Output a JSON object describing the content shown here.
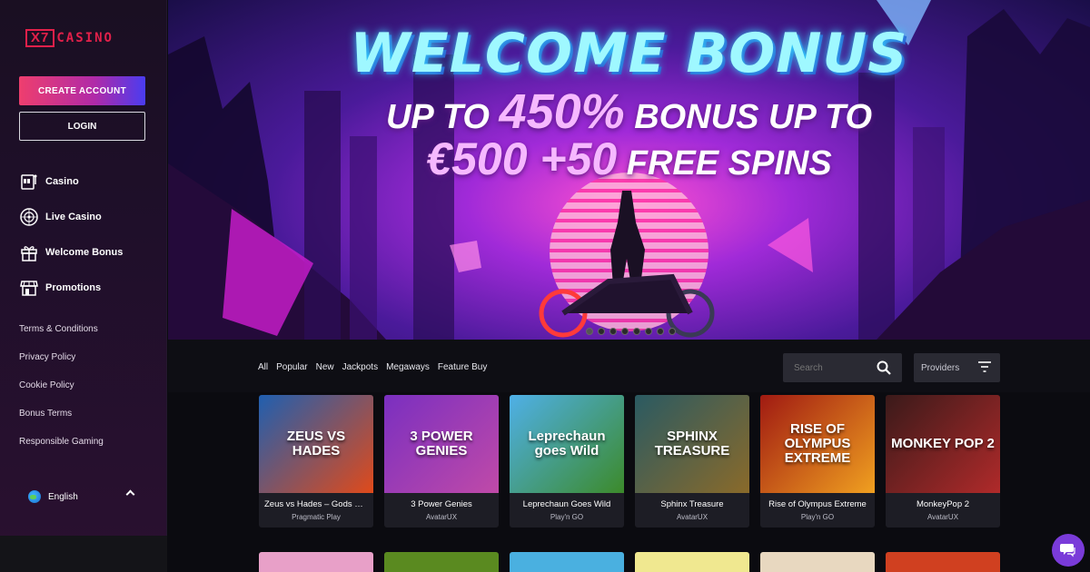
{
  "brand": {
    "logo_box": "X7",
    "logo_text": "CASINO"
  },
  "sidebar": {
    "create_account": "CREATE ACCOUNT",
    "login": "LOGIN",
    "nav": [
      {
        "label": "Casino",
        "icon": "slot-machine-icon"
      },
      {
        "label": "Live Casino",
        "icon": "roulette-icon"
      },
      {
        "label": "Welcome Bonus",
        "icon": "gift-icon"
      },
      {
        "label": "Promotions",
        "icon": "store-icon"
      }
    ],
    "links": [
      "Terms & Conditions",
      "Privacy Policy",
      "Cookie Policy",
      "Bonus Terms",
      "Responsible Gaming"
    ],
    "language": "English"
  },
  "banner": {
    "line1": "WELCOME BONUS",
    "line2_pre": "UP TO",
    "line2_big": "450%",
    "line2_post": "BONUS UP TO",
    "line3_big": "€500 +50",
    "line3_post": "FREE SPINS",
    "slides": 8,
    "active_slide": 0
  },
  "filters": [
    "All",
    "Popular",
    "New",
    "Jackpots",
    "Megaways",
    "Feature Buy"
  ],
  "search": {
    "placeholder": "Search"
  },
  "providers_label": "Providers",
  "games": [
    {
      "name": "Zeus vs Hades – Gods of ...",
      "provider": "Pragmatic Play",
      "art": "ZEUS VS HADES",
      "c1": "#1f5fb0",
      "c2": "#e04a1a"
    },
    {
      "name": "3 Power Genies",
      "provider": "AvatarUX",
      "art": "3 POWER GENIES",
      "c1": "#7a2fc0",
      "c2": "#c04aa8"
    },
    {
      "name": "Leprechaun Goes Wild",
      "provider": "Play'n GO",
      "art": "Leprechaun goes Wild",
      "c1": "#4fb0e8",
      "c2": "#3c8a2a"
    },
    {
      "name": "Sphinx Treasure",
      "provider": "AvatarUX",
      "art": "SPHINX TREASURE",
      "c1": "#2a5a62",
      "c2": "#8a6a2a"
    },
    {
      "name": "Rise of Olympus Extreme",
      "provider": "Play'n GO",
      "art": "RISE OF OLYMPUS EXTREME",
      "c1": "#a01a12",
      "c2": "#f0a020"
    },
    {
      "name": "MonkeyPop 2",
      "provider": "AvatarUX",
      "art": "MONKEY POP 2",
      "c1": "#3a1a1a",
      "c2": "#b02a2a"
    }
  ],
  "row2_colors": [
    "#e8a0c8",
    "#5a8a20",
    "#4ab0e0",
    "#f0e890",
    "#e8d8c0",
    "#d04020"
  ]
}
